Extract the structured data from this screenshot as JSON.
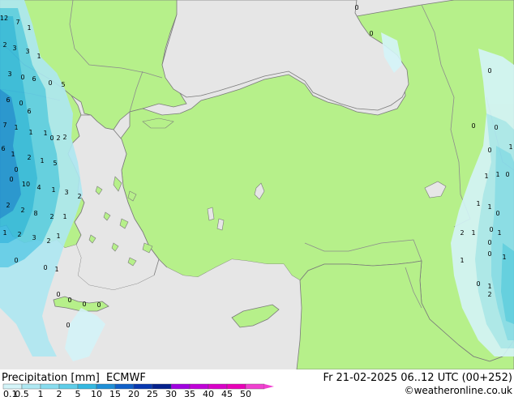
{
  "legend": {
    "title": "Precipitation [mm]",
    "model": "ECMWF",
    "datetime": "Fr 21-02-2025 06..12 UTC (00+252)",
    "copyright": "©weatheronline.co.uk",
    "ticks": [
      "0.1",
      "0.5",
      "1",
      "2",
      "5",
      "10",
      "15",
      "20",
      "25",
      "30",
      "35",
      "40",
      "45",
      "50"
    ],
    "colors": [
      "#d4f4f8",
      "#aee8f2",
      "#88dcee",
      "#5ecde8",
      "#34b8e0",
      "#1e8fd6",
      "#1060c8",
      "#0838b0",
      "#04208c",
      "#a000e0",
      "#c000d8",
      "#d800c8",
      "#e800b8",
      "#f040d0"
    ]
  },
  "map_colors": {
    "sea": "#e6e6e6",
    "land": "#b6f08a",
    "border": "#8c8c8c",
    "coast": "#7a7a7a"
  },
  "cell_values": [
    "12",
    "7",
    "1",
    "2",
    "3",
    "3",
    "1",
    "3",
    "0",
    "6",
    "0",
    "5",
    "6",
    "0",
    "6",
    "7",
    "1",
    "1",
    "1",
    "0",
    "2",
    "2",
    "6",
    "1",
    "2",
    "0",
    "1",
    "5",
    "0",
    "10",
    "4",
    "1",
    "3",
    "2",
    "2",
    "8",
    "2",
    "1",
    "2",
    "1",
    "2",
    "3",
    "2",
    "1",
    "0",
    "0",
    "1",
    "0",
    "0",
    "0",
    "0",
    "0",
    "0",
    "0",
    "0",
    "0",
    "0",
    "0",
    "1",
    "1",
    "1",
    "0",
    "1",
    "1",
    "0",
    "2",
    "1",
    "0",
    "1",
    "0",
    "1",
    "0",
    "1",
    "0",
    "1",
    "2"
  ]
}
